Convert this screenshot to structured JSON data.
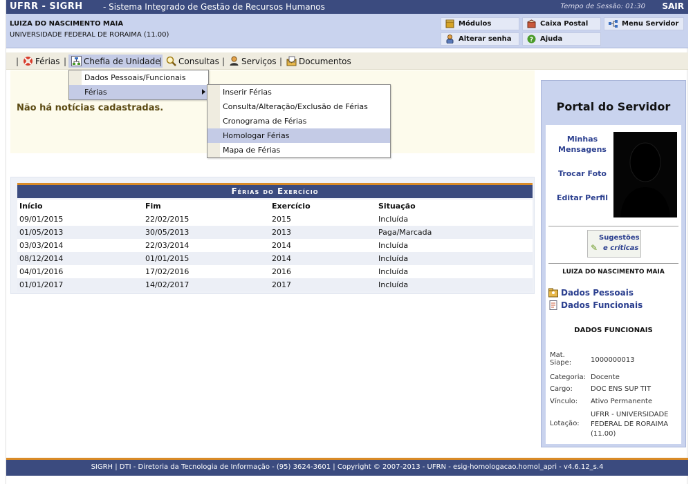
{
  "header": {
    "brand": "UFRR - SIGRH",
    "system_name": "- Sistema Integrado de Gestão de Recursos Humanos",
    "session_label": "Tempo de Sessão: 01:30",
    "exit_label": "SAIR"
  },
  "user": {
    "name": "LUIZA DO NASCIMENTO MAIA",
    "org": "UNIVERSIDADE FEDERAL DE RORAIMA (11.00)"
  },
  "quick_links": {
    "modulos": "Módulos",
    "caixa_postal": "Caixa Postal",
    "menu_servidor": "Menu Servidor",
    "alterar_senha": "Alterar senha",
    "ajuda": "Ajuda"
  },
  "menu": {
    "ferias": "Férias",
    "chefia": "Chefia de Unidade",
    "consultas": "Consultas",
    "servicos": "Serviços",
    "documentos": "Documentos",
    "separator": "|"
  },
  "chefia_dropdown": {
    "items": [
      "Dados Pessoais/Funcionais",
      "Férias"
    ]
  },
  "ferias_submenu": {
    "items": [
      "Inserir Férias",
      "Consulta/Alteração/Exclusão de Férias",
      "Cronograma de Férias",
      "Homologar Férias",
      "Mapa de Férias"
    ],
    "highlighted_index": 3
  },
  "news": {
    "message": "Não há notícias cadastradas."
  },
  "ferias_table": {
    "caption": "Férias do Exercício",
    "columns": [
      "Início",
      "Fim",
      "Exercício",
      "Situação"
    ],
    "rows": [
      [
        "09/01/2015",
        "22/02/2015",
        "2015",
        "Incluída"
      ],
      [
        "01/05/2013",
        "30/05/2013",
        "2013",
        "Paga/Marcada"
      ],
      [
        "03/03/2014",
        "22/03/2014",
        "2014",
        "Incluída"
      ],
      [
        "08/12/2014",
        "01/01/2015",
        "2014",
        "Incluída"
      ],
      [
        "04/01/2016",
        "17/02/2016",
        "2016",
        "Incluída"
      ],
      [
        "01/01/2017",
        "14/02/2017",
        "2017",
        "Incluída"
      ]
    ]
  },
  "portal": {
    "title": "Portal do Servidor",
    "minhas": "Minhas",
    "mensagens": "Mensagens",
    "trocar_foto": "Trocar Foto",
    "editar_perfil": "Editar Perfil",
    "sugestoes": "Sugestões",
    "criticas": "e críticas",
    "user_name": "LUIZA DO NASCIMENTO MAIA",
    "dados_pessoais": "Dados Pessoais",
    "dados_funcionais": "Dados Funcionais",
    "dados_funcionais_title": "DADOS FUNCIONAIS",
    "fields": {
      "mat_siape_label": "Mat. Siape:",
      "mat_siape": "1000000013",
      "categoria_label": "Categoria:",
      "categoria": "Docente",
      "cargo_label": "Cargo:",
      "cargo": "DOC ENS SUP TIT",
      "vinculo_label": "Vínculo:",
      "vinculo": "Ativo Permanente",
      "lotacao_label": "Lotação:",
      "lotacao": "UFRR - UNIVERSIDADE FEDERAL DE RORAIMA (11.00)"
    }
  },
  "footer": {
    "text": "SIGRH | DTI - Diretoria da Tecnologia de Informação - (95) 3624-3601 | Copyright © 2007-2013 - UFRN - esig-homologacao.homol_apri - v4.6.12_s.4"
  },
  "colors": {
    "header_bg": "#3b4b7f",
    "accent_orange": "#d98b27",
    "panel_blue": "#c9d3ee",
    "link_blue": "#2b3f8f",
    "news_text": "#5b4a13"
  }
}
